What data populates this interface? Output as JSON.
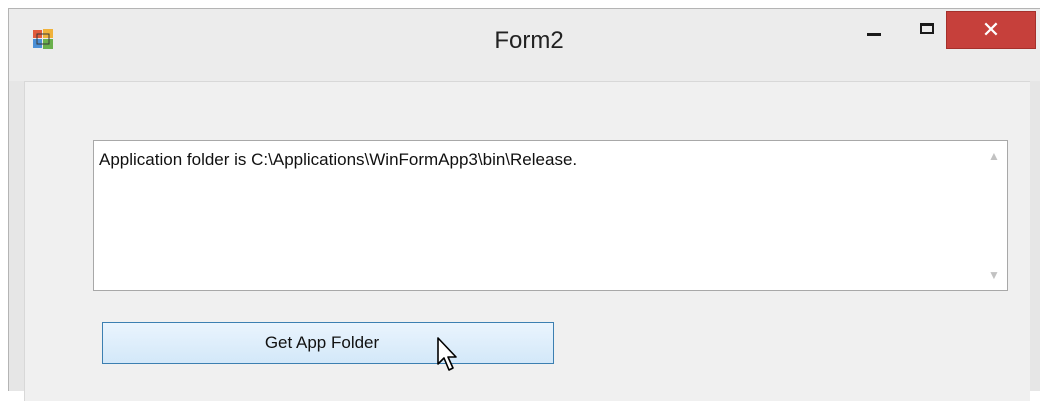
{
  "window": {
    "title": "Form2",
    "icon": "app-icon",
    "controls": {
      "minimize_icon": "minimize-icon",
      "maximize_icon": "maximize-icon",
      "close_glyph": "✕"
    }
  },
  "form": {
    "output_text": "Application folder is C:\\Applications\\WinFormApp3\\bin\\Release.",
    "scroll_up_glyph": "▲",
    "scroll_down_glyph": "▼",
    "button_label": "Get App Folder"
  },
  "colors": {
    "close_button": "#c6403b",
    "button_border": "#3c7fb1",
    "client_background": "#f0f0f0"
  }
}
